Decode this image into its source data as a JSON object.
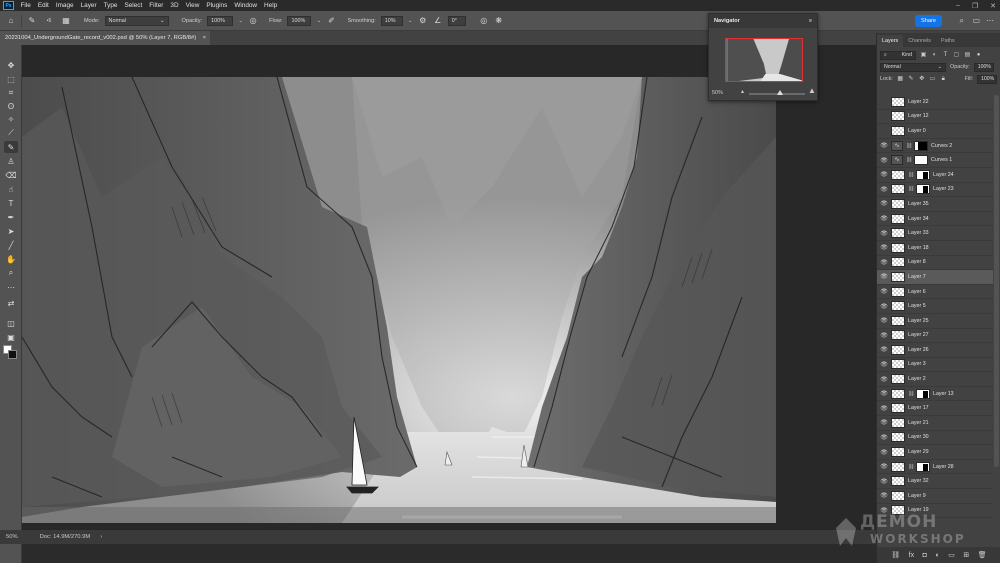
{
  "app": {
    "logo": "Ps",
    "menu": [
      "File",
      "Edit",
      "Image",
      "Layer",
      "Type",
      "Select",
      "Filter",
      "3D",
      "View",
      "Plugins",
      "Window",
      "Help"
    ],
    "window_controls": [
      "–",
      "❐",
      "✕"
    ]
  },
  "options": {
    "brush_size": "5",
    "mode_label": "Mode:",
    "mode_value": "Normal",
    "opacity_label": "Opacity:",
    "opacity_value": "100%",
    "flow_label": "Flow:",
    "flow_value": "100%",
    "smoothing_label": "Smoothing:",
    "smoothing_value": "10%",
    "angle_value": "0°",
    "share_label": "Share"
  },
  "document": {
    "tab_title": "20231004_UndergroundGate_record_v002.psd @ 50% (Layer 7, RGB/8#)",
    "close": "×"
  },
  "status": {
    "zoom": "50%",
    "doc_size": "Doc: 14.9M/270.9M"
  },
  "navigator": {
    "title": "Navigator",
    "zoom": "50%"
  },
  "layers_panel": {
    "tabs": [
      "Layers",
      "Channels",
      "Paths"
    ],
    "filter_kind": "Kind",
    "blend_mode": "Normal",
    "opacity_label": "Opacity:",
    "opacity_value": "100%",
    "lock_label": "Lock:",
    "fill_label": "Fill:",
    "fill_value": "100%",
    "layers": [
      {
        "name": "Layer 22",
        "visible": false,
        "type": "pixel"
      },
      {
        "name": "Layer 12",
        "visible": false,
        "type": "pixel"
      },
      {
        "name": "Layer 0",
        "visible": false,
        "type": "pixel"
      },
      {
        "name": "Curves 2",
        "visible": true,
        "type": "adjustment"
      },
      {
        "name": "Curves 1",
        "visible": true,
        "type": "adjustment"
      },
      {
        "name": "Layer 24",
        "visible": true,
        "type": "masked"
      },
      {
        "name": "Layer 23",
        "visible": true,
        "type": "masked"
      },
      {
        "name": "Layer 35",
        "visible": true,
        "type": "pixel"
      },
      {
        "name": "Layer 34",
        "visible": true,
        "type": "pixel"
      },
      {
        "name": "Layer 33",
        "visible": true,
        "type": "pixel"
      },
      {
        "name": "Layer 18",
        "visible": true,
        "type": "pixel"
      },
      {
        "name": "Layer 8",
        "visible": true,
        "type": "pixel"
      },
      {
        "name": "Layer 7",
        "visible": true,
        "type": "pixel",
        "selected": true
      },
      {
        "name": "Layer 6",
        "visible": true,
        "type": "pixel"
      },
      {
        "name": "Layer 5",
        "visible": true,
        "type": "pixel"
      },
      {
        "name": "Layer 25",
        "visible": true,
        "type": "pixel"
      },
      {
        "name": "Layer 27",
        "visible": true,
        "type": "pixel"
      },
      {
        "name": "Layer 26",
        "visible": true,
        "type": "pixel"
      },
      {
        "name": "Layer 3",
        "visible": true,
        "type": "pixel"
      },
      {
        "name": "Layer 2",
        "visible": true,
        "type": "pixel"
      },
      {
        "name": "Layer 13",
        "visible": true,
        "type": "masked"
      },
      {
        "name": "Layer 17",
        "visible": true,
        "type": "pixel"
      },
      {
        "name": "Layer 21",
        "visible": true,
        "type": "pixel"
      },
      {
        "name": "Layer 30",
        "visible": true,
        "type": "pixel"
      },
      {
        "name": "Layer 29",
        "visible": true,
        "type": "pixel"
      },
      {
        "name": "Layer 28",
        "visible": true,
        "type": "masked"
      },
      {
        "name": "Layer 32",
        "visible": true,
        "type": "pixel"
      },
      {
        "name": "Layer 9",
        "visible": true,
        "type": "pixel"
      },
      {
        "name": "Layer 19",
        "visible": true,
        "type": "pixel"
      }
    ]
  }
}
